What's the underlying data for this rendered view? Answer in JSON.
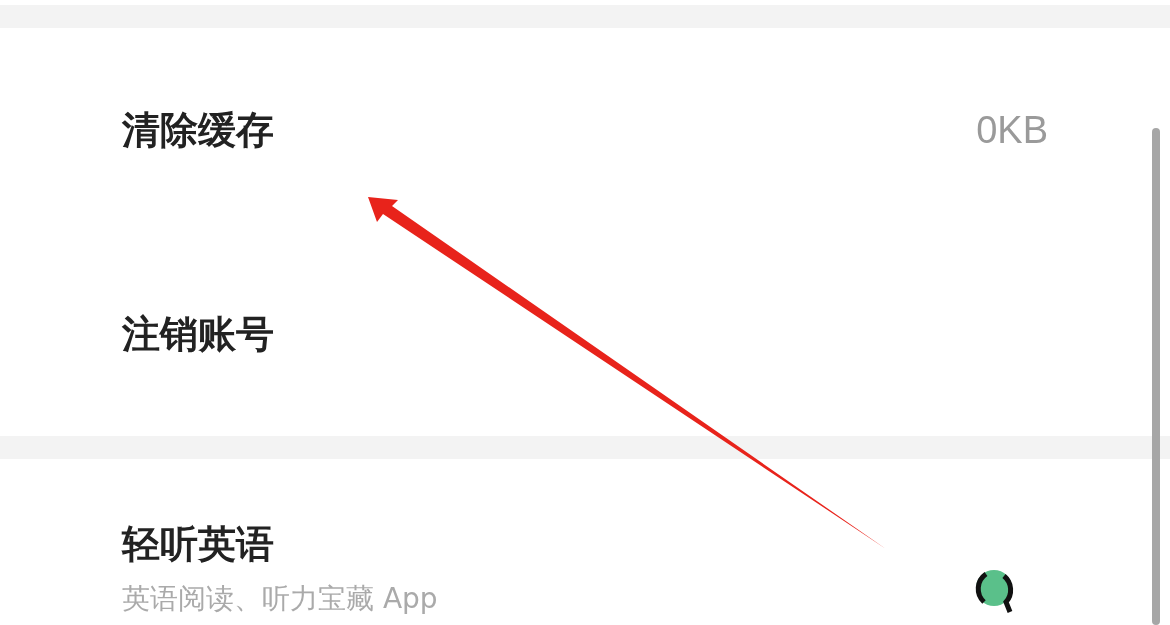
{
  "settings": [
    {
      "label": "清除缓存",
      "value": "0KB"
    },
    {
      "label": "注销账号"
    }
  ],
  "app_card": {
    "title": "轻听英语",
    "subtitle": "英语阅读、听力宝藏 App"
  }
}
